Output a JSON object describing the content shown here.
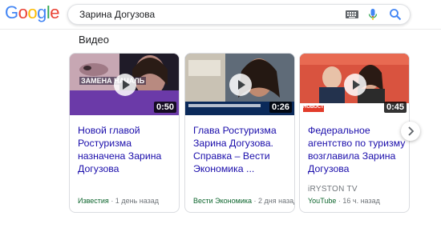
{
  "header": {
    "logo_letters": [
      {
        "ch": "G",
        "color": "#4285f4"
      },
      {
        "ch": "o",
        "color": "#ea4335"
      },
      {
        "ch": "o",
        "color": "#fbbc05"
      },
      {
        "ch": "g",
        "color": "#4285f4"
      },
      {
        "ch": "l",
        "color": "#34a853"
      },
      {
        "ch": "e",
        "color": "#ea4335"
      }
    ],
    "search_value": "Зарина Догузова",
    "icons": [
      "keyboard-icon",
      "microphone-icon",
      "search-icon"
    ]
  },
  "section": {
    "title": "Видео"
  },
  "videos": [
    {
      "thumb_text": "ЗАМЕНА НАЧАЛЬ",
      "duration": "0:50",
      "title": "Новой главой Ростуризма назначена Зарина Догузова",
      "channel": "",
      "source": "Известия",
      "age": " · 1 день назад"
    },
    {
      "thumb_text": "",
      "duration": "0:26",
      "title": "Глава Ростуризма Зарина Догузова. Справка – Вести Экономика ...",
      "channel": "",
      "source": "Вести Экономика",
      "age": " · 2 дня назад"
    },
    {
      "thumb_text": "НОВОСТИ",
      "duration": "0:45",
      "title": "Федеральное агентство по туризму возглавила Зарина Догузова",
      "channel": "iRYSTON TV",
      "source": "YouTube",
      "age": " · 16 ч. назад"
    }
  ],
  "colors": {
    "link": "#1a0dab",
    "source_green": "#0d652d",
    "meta_gray": "#70757a"
  }
}
